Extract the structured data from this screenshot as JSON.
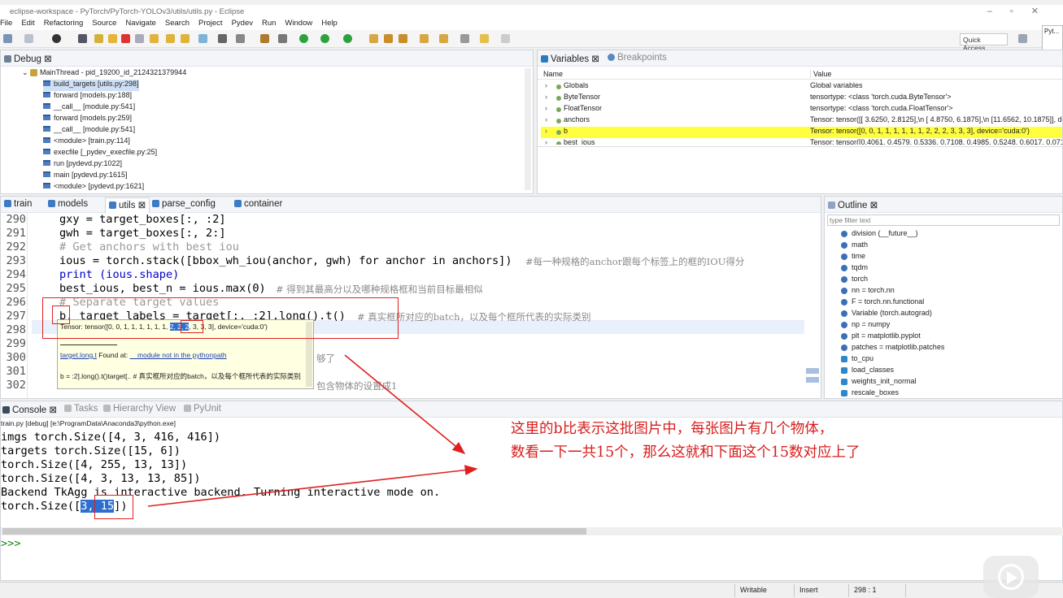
{
  "window": {
    "title": "eclipse-workspace - PyTorch/PyTorch-YOLOv3/utils/utils.py - Eclipse"
  },
  "menu": [
    "File",
    "Edit",
    "Refactoring",
    "Source",
    "Navigate",
    "Search",
    "Project",
    "Pydev",
    "Run",
    "Window",
    "Help"
  ],
  "toolbar": {
    "quick_access": "Quick Access",
    "perspective": "Pyt..."
  },
  "debug": {
    "tab": "Debug",
    "thread": "MainThread - pid_19200_id_2124321379944",
    "frames": [
      "build_targets [utils.py:298]",
      "forward [models.py:188]",
      "__call__ [module.py:541]",
      "forward [models.py:259]",
      "__call__ [module.py:541]",
      "<module> [train.py:114]",
      "execfile [_pydev_execfile.py:25]",
      "run [pydevd.py:1022]",
      "main [pydevd.py:1615]",
      "<module> [pydevd.py:1621]"
    ]
  },
  "variables": {
    "tab": "Variables",
    "tab2": "Breakpoints",
    "col_name": "Name",
    "col_value": "Value",
    "rows": [
      {
        "name": "Globals",
        "value": "Global variables"
      },
      {
        "name": "ByteTensor",
        "value": "tensortype: <class 'torch.cuda.ByteTensor'>"
      },
      {
        "name": "FloatTensor",
        "value": "tensortype: <class 'torch.cuda.FloatTensor'>"
      },
      {
        "name": "anchors",
        "value": "Tensor: tensor([[ 3.6250,  2.8125],\\n        [ 4.8750,  6.1875],\\n        [11.6562, 10.1875]], device='cuda:0')"
      },
      {
        "name": "b",
        "value": "Tensor: tensor([0, 0, 1, 1, 1, 1, 1, 1, 2, 2, 2, 3, 3, 3], device='cuda:0')"
      },
      {
        "name": "best_ious",
        "value": "Tensor: tensor([0.4061, 0.4579, 0.5336, 0.7108, 0.4985, 0.5248, 0.6017, 0.0715"
      }
    ]
  },
  "editor": {
    "tabs": [
      "train",
      "models",
      "utils",
      "parse_config",
      "container"
    ],
    "lines": [
      {
        "n": "290",
        "code": "gxy = target_boxes[:, :2]"
      },
      {
        "n": "291",
        "code": "gwh = target_boxes[:, 2:]"
      },
      {
        "n": "292",
        "code": "# Get anchors with best iou"
      },
      {
        "n": "293",
        "code": "ious = torch.stack([bbox_wh_iou(anchor, gwh) for anchor in anchors])",
        "comment": "#每一种规格的anchor跟每个标签上的框的IOU得分"
      },
      {
        "n": "294",
        "code": "print (ious.shape)"
      },
      {
        "n": "295",
        "code": "best_ious, best_n = ious.max(0)",
        "comment": "# 得到其最高分以及哪种规格框和当前目标最相似"
      },
      {
        "n": "296",
        "code": "# Separate target values"
      },
      {
        "n": "297",
        "code": "b, target_labels = target[:, :2].long().t()",
        "comment": "# 真实框所对应的batch，以及每个框所代表的实际类别"
      },
      {
        "n": "298",
        "code": ""
      },
      {
        "n": "299",
        "code": ""
      },
      {
        "n": "300",
        "code": "",
        "comment": "够了"
      },
      {
        "n": "301",
        "code": ""
      },
      {
        "n": "302",
        "code": "",
        "comment": "包含物体的设置成1"
      }
    ],
    "tooltip": {
      "value_prefix": "Tensor: tensor([0, 0, 1, 1, 1, 1, 1, 1, ",
      "value_sel": "2, 2, 2",
      "value_suffix": ", 3, 3, 3], device='cuda:0')",
      "link": "target.long.t",
      "found_at": "Found at:",
      "module": "__module not in the pythonpath",
      "code_line": "b = :2].long().t()target[.. # 真实框所对应的batch，以及每个框所代表的实际类别"
    }
  },
  "outline": {
    "tab": "Outline",
    "filter_placeholder": "type filter text",
    "items": [
      "division (__future__)",
      "math",
      "time",
      "tqdm",
      "torch",
      "nn = torch.nn",
      "F = torch.nn.functional",
      "Variable (torch.autograd)",
      "np = numpy",
      "plt = matplotlib.pyplot",
      "patches = matplotlib.patches",
      "to_cpu",
      "load_classes",
      "weights_init_normal",
      "rescale_boxes"
    ]
  },
  "console": {
    "tabs": [
      "Console",
      "Tasks",
      "Hierarchy View",
      "PyUnit"
    ],
    "header": "train.py [debug] [e:\\ProgramData\\Anaconda3\\python.exe]",
    "lines": [
      "imgs torch.Size([4, 3, 416, 416])",
      "targets torch.Size([15, 6])",
      "torch.Size([4, 255, 13, 13])",
      "torch.Size([4, 3, 13, 13, 85])",
      "Backend TkAgg is interactive backend. Turning interactive mode on."
    ],
    "last_prefix": "torch.Size([",
    "last_sel": "3, 15",
    "last_suffix": "])",
    "prompt": ">>>"
  },
  "status": {
    "writable": "Writable",
    "insert": "Insert",
    "position": "298 : 1"
  },
  "annotation": {
    "line1": "这里的b比表示这批图片中，每张图片有几个物体，",
    "line2": "数看一下一共15个，那么这就和下面这个15数对应上了"
  },
  "colors": {
    "accent": "#2d6fce",
    "annotation": "#d81c1c",
    "highlight": "#ffff40"
  }
}
